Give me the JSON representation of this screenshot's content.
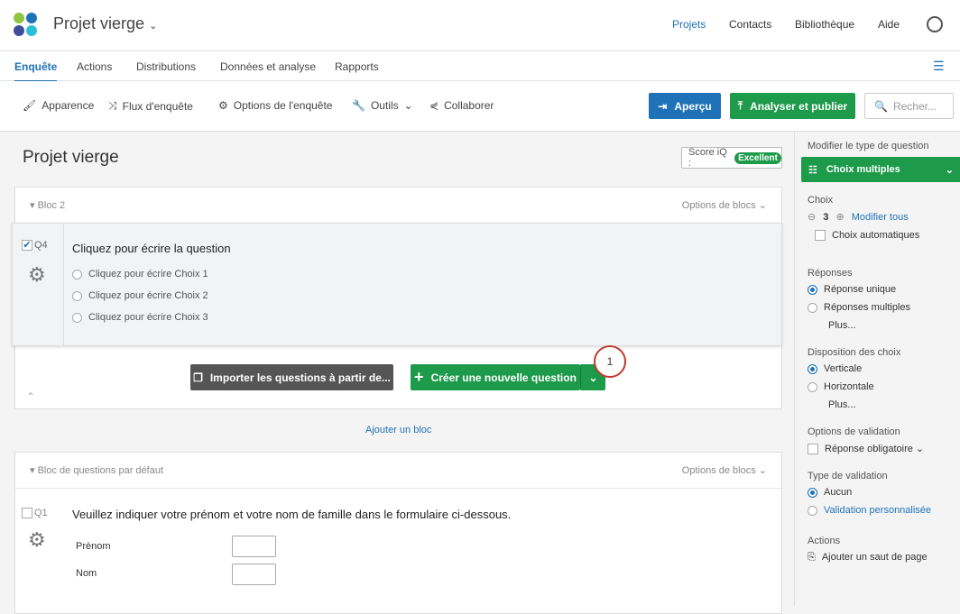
{
  "header": {
    "project_title": "Projet vierge",
    "nav": [
      "Projets",
      "Contacts",
      "Bibliothèque",
      "Aide"
    ]
  },
  "tabs": [
    "Enquête",
    "Actions",
    "Distributions",
    "Données et analyse",
    "Rapports"
  ],
  "toolbar": {
    "items": [
      "Apparence",
      "Flux d'enquête",
      "Options de l'enquête",
      "Outils",
      "Collaborer"
    ],
    "preview": "Aperçu",
    "publish": "Analyser et publier",
    "search_placeholder": "Recher..."
  },
  "survey": {
    "title": "Projet vierge",
    "score_label": "Score iQ :",
    "score_value": "Excellent",
    "block2": {
      "title": "Bloc 2",
      "options": "Options de blocs",
      "q_id": "Q4",
      "question": "Cliquez pour écrire la question",
      "choices": [
        "Cliquez pour écrire Choix 1",
        "Cliquez pour écrire Choix 2",
        "Cliquez pour écrire Choix 3"
      ],
      "import": "Importer les questions à partir de...",
      "create": "Créer une nouvelle question",
      "badge": "1"
    },
    "add_block": "Ajouter un bloc",
    "default_block": {
      "title": "Bloc de questions par défaut",
      "options": "Options de blocs",
      "q_id": "Q1",
      "question": "Veuillez indiquer votre prénom et votre nom de famille dans le formulaire ci-dessous.",
      "fields": [
        "Prènom",
        "Nom"
      ]
    }
  },
  "sidebar": {
    "change_type": "Modifier le type de question",
    "type": "Choix multiples",
    "choices_label": "Choix",
    "choices_count": "3",
    "edit_all": "Modifier tous",
    "auto_choices": "Choix automatiques",
    "answers_label": "Réponses",
    "answers": [
      "Réponse unique",
      "Réponses multiples"
    ],
    "more": "Plus...",
    "layout_label": "Disposition des choix",
    "layouts": [
      "Verticale",
      "Horizontale"
    ],
    "validation_options_label": "Options de validation",
    "required": "Réponse obligatoire",
    "validation_type_label": "Type de validation",
    "validation_types": [
      "Aucun",
      "Validation personnalisée"
    ],
    "actions_label": "Actions",
    "page_break": "Ajouter un saut de page"
  },
  "colors": {
    "green": "#1d9a4a",
    "blue": "#1f72b8",
    "dark": "#555"
  }
}
